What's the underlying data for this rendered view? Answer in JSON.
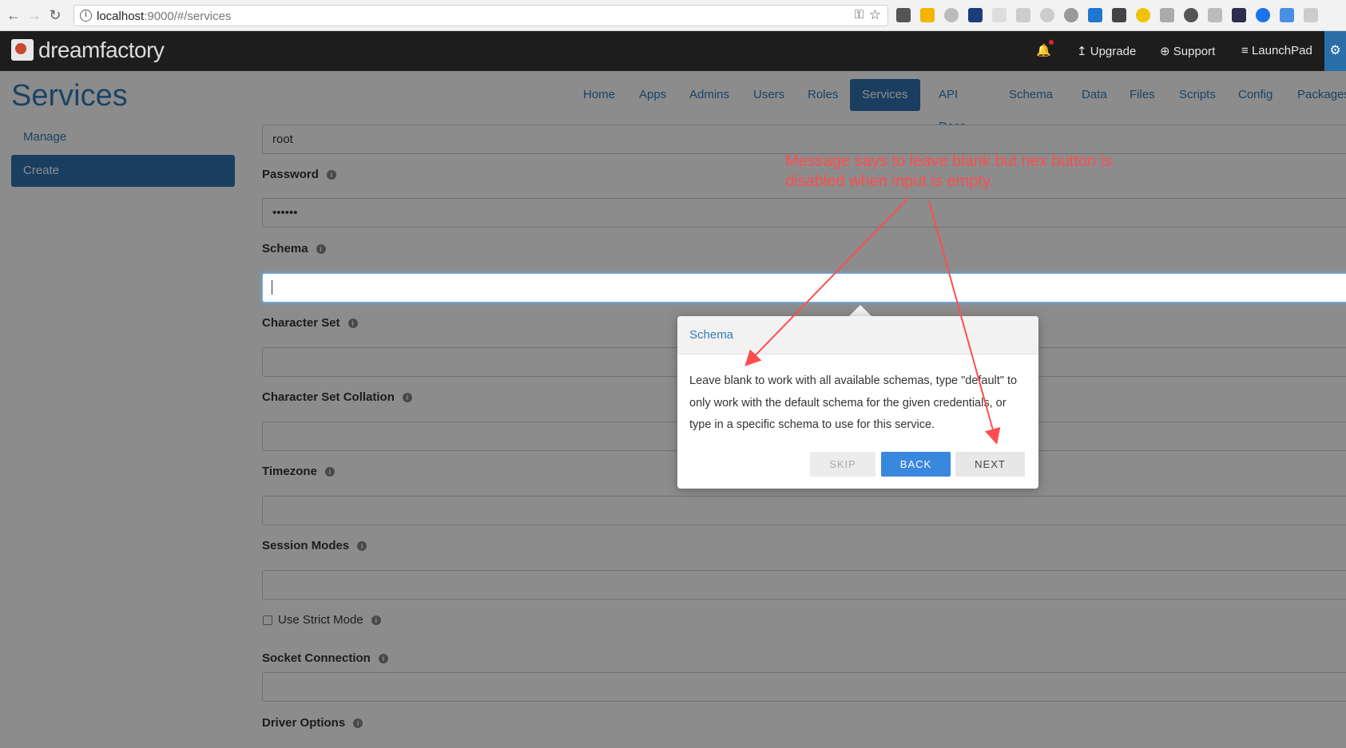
{
  "browser": {
    "url_host": "localhost",
    "url_rest": ":9000/#/services"
  },
  "header": {
    "logo_text": "dreamfactory",
    "upgrade": "Upgrade",
    "support": "Support",
    "launchpad": "LaunchPad"
  },
  "page": {
    "title": "Services",
    "nav": [
      {
        "label": "Home"
      },
      {
        "label": "Apps"
      },
      {
        "label": "Admins"
      },
      {
        "label": "Users"
      },
      {
        "label": "Roles"
      },
      {
        "label": "Services",
        "active": true
      },
      {
        "label": "API Docs"
      },
      {
        "label": "Schema"
      },
      {
        "label": "Data"
      },
      {
        "label": "Files"
      },
      {
        "label": "Scripts"
      },
      {
        "label": "Config"
      },
      {
        "label": "Packages"
      }
    ],
    "sidebar": {
      "manage": "Manage",
      "create": "Create"
    }
  },
  "form": {
    "username_value": "root",
    "password_label": "Password",
    "password_value": "••••••",
    "schema_label": "Schema",
    "schema_value": "",
    "charset_label": "Character Set",
    "collation_label": "Character Set Collation",
    "timezone_label": "Timezone",
    "session_modes_label": "Session Modes",
    "strict_mode_label": "Use Strict Mode",
    "socket_label": "Socket Connection",
    "driver_options_label": "Driver Options"
  },
  "popover": {
    "title": "Schema",
    "body": "Leave blank to work with all available schemas, type \"default\" to only work with the default schema for the given credentials, or type in a specific schema to use for this service.",
    "skip": "SKIP",
    "back": "BACK",
    "next": "NEXT"
  },
  "annotation": {
    "text": "Message says to leave blank but nex button is disabled when input is empty.",
    "color": "#ff4d4d"
  }
}
